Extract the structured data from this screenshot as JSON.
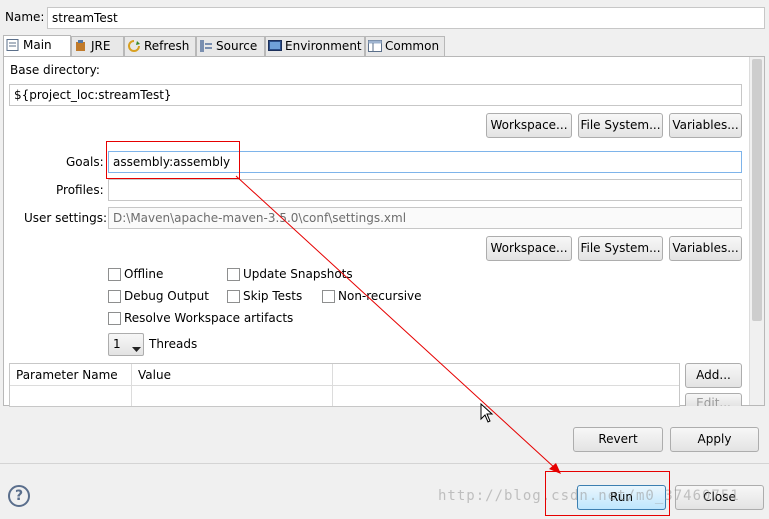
{
  "name": {
    "label": "Name:",
    "value": "streamTest"
  },
  "tabs": [
    {
      "label": "Main",
      "icon": "main-tab-icon"
    },
    {
      "label": "JRE",
      "icon": "jre-icon"
    },
    {
      "label": "Refresh",
      "icon": "refresh-icon"
    },
    {
      "label": "Source",
      "icon": "source-icon"
    },
    {
      "label": "Environment",
      "icon": "environment-icon"
    },
    {
      "label": "Common",
      "icon": "common-icon"
    }
  ],
  "main": {
    "base_dir_label": "Base directory:",
    "base_dir_value": "${project_loc:streamTest}",
    "btn_workspace": "Workspace...",
    "btn_filesystem": "File System...",
    "btn_variables": "Variables...",
    "goals_label": "Goals:",
    "goals_value": "assembly:assembly",
    "profiles_label": "Profiles:",
    "profiles_value": "",
    "user_settings_label": "User settings:",
    "user_settings_value": "D:\\Maven\\apache-maven-3.5.0\\conf\\settings.xml",
    "checkboxes": {
      "offline": "Offline",
      "update_snapshots": "Update Snapshots",
      "debug_output": "Debug Output",
      "skip_tests": "Skip Tests",
      "non_recursive": "Non-recursive",
      "resolve_workspace": "Resolve Workspace artifacts"
    },
    "threads_value": "1",
    "threads_label": "Threads",
    "param_table": {
      "headers": [
        "Parameter Name",
        "Value"
      ]
    },
    "btn_add": "Add...",
    "btn_edit": "Edit..."
  },
  "footer": {
    "revert": "Revert",
    "apply": "Apply",
    "run": "Run",
    "close": "Close",
    "help_glyph": "?",
    "watermark": "http://blog.csdn.net/m0_37460751"
  },
  "colors": {
    "annotation_red": "#e60000",
    "accent_blue": "#3c7fb1"
  }
}
